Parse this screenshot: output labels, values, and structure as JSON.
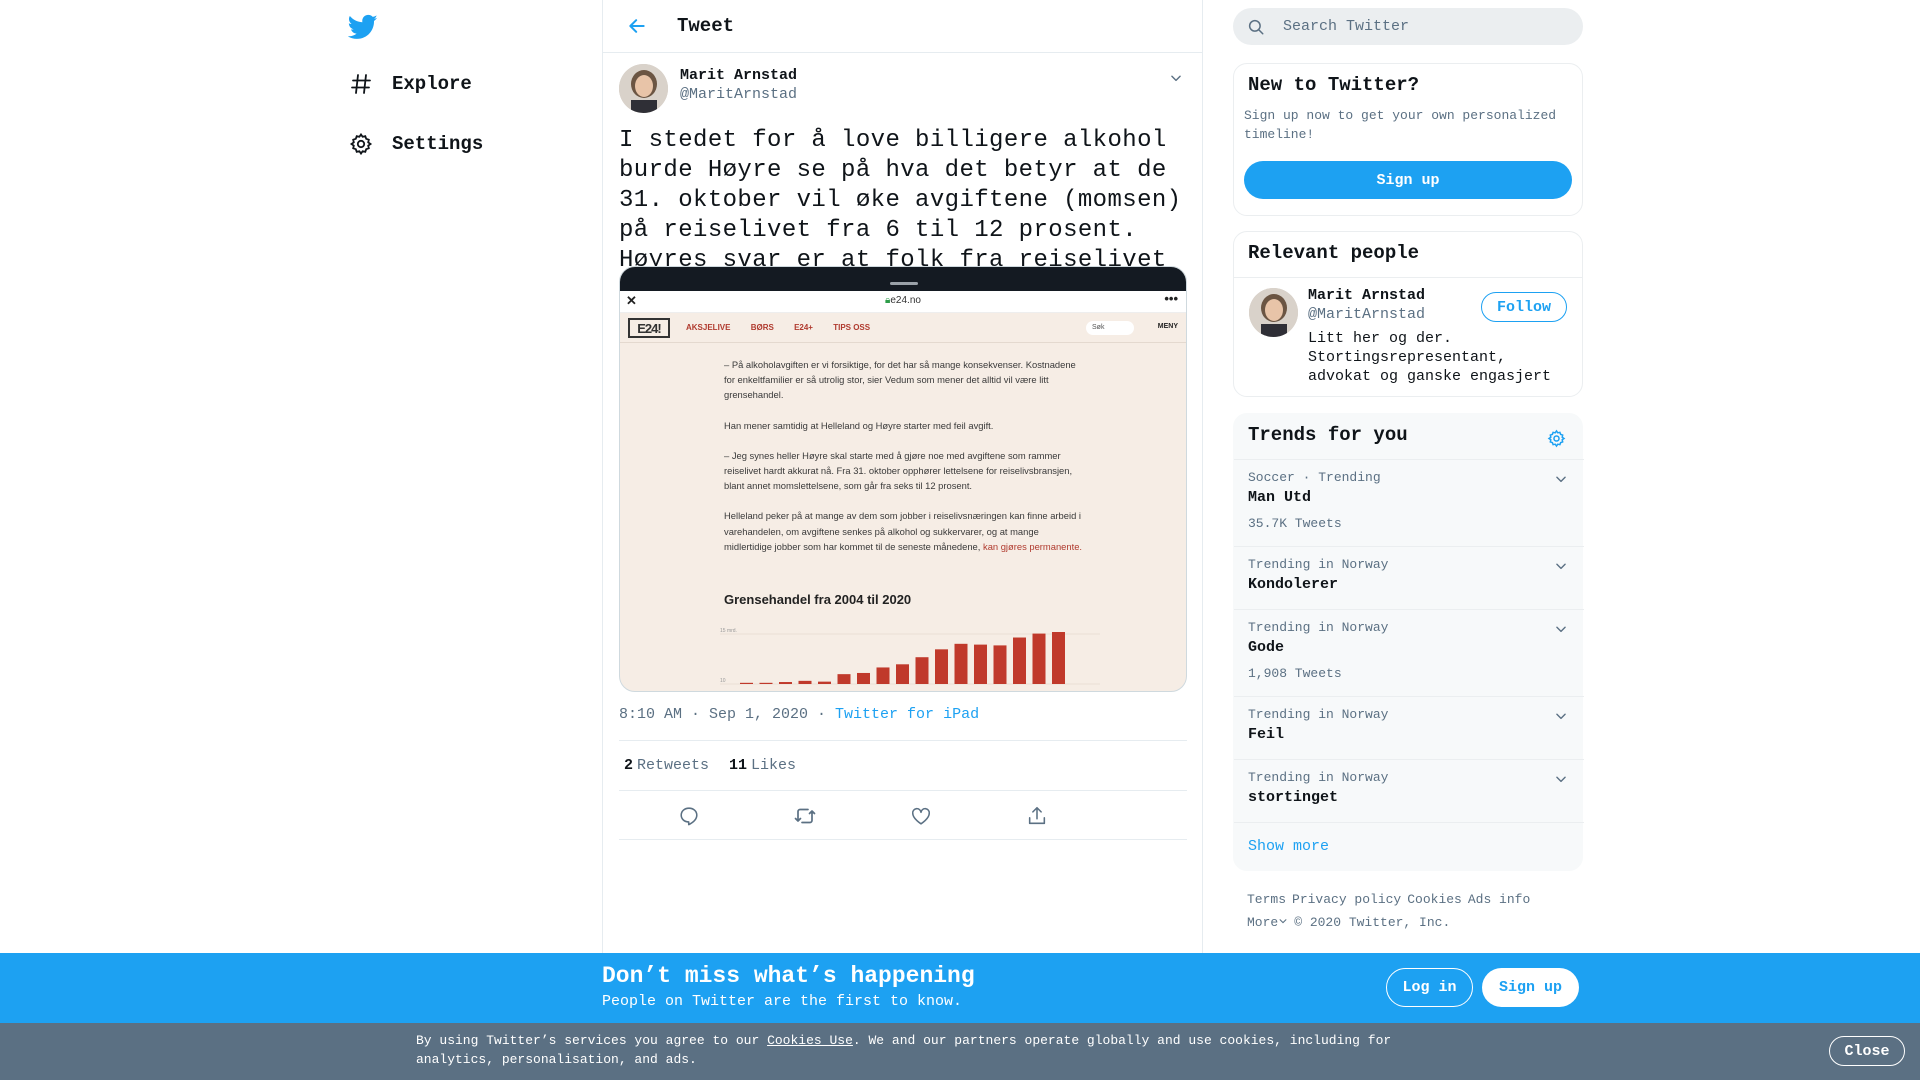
{
  "nav": {
    "explore_label": "Explore",
    "settings_label": "Settings"
  },
  "header": {
    "title": "Tweet"
  },
  "tweet": {
    "author_name": "Marit Arnstad",
    "author_handle": "@MaritArnstad",
    "text": "I stedet for å love billigere alkohol burde Høyre se på hva det betyr at de 31. oktober vil øke avgiftene (momsen) på reiselivet fra 6 til 12 prosent. Høyres svar er at folk fra reiselivet kan finne arbeid i varehandelen (??)",
    "time": "8:10 AM · Sep 1, 2020",
    "separator": " · ",
    "source": "Twitter for iPad",
    "retweets_count": "2",
    "retweets_label": "Retweets",
    "likes_count": "11",
    "likes_label": "Likes"
  },
  "media": {
    "url": "e24.no",
    "close": "✕",
    "more": "•••",
    "logo": "E24!",
    "nav_links": [
      "AKSJELIVE",
      "BØRS",
      "E24+",
      "TIPS OSS"
    ],
    "search": "Søk",
    "menu": "MENY",
    "paragraphs": [
      "– På alkoholavgiften er vi forsiktige, for det har så mange konsekvenser. Kostnadene for enkeltfamilier er så utrolig stor, sier Vedum som mener det alltid vil være litt grensehandel.",
      "Han mener samtidig at Helleland og Høyre starter med feil avgift.",
      "– Jeg synes heller Høyre skal starte med å gjøre noe med avgiftene som rammer reiselivet hardt akkurat nå. Fra 31. oktober opphører lettelsene for reiselivsbransjen, blant annet momslettelsene, som går fra seks til 12 prosent.",
      "Helleland peker på at mange av dem som jobber i reiselivsnæringen kan finne arbeid i varehandelen, om avgiftene senkes på alkohol og sukkervarer, og at mange midlertidige jobber som har kommet til de seneste månedene,"
    ],
    "link_text": "kan gjøres permanente.",
    "chart_title": "Grensehandel fra 2004 til 2020",
    "y_tick_top": "15 mrd.",
    "y_tick_bottom": "10"
  },
  "chart_data": {
    "type": "bar",
    "title": "Grensehandel fra 2004 til 2020",
    "values": [
      0.3,
      0.3,
      0.5,
      0.8,
      0.6,
      2.5,
      2.8,
      4.2,
      5.0,
      6.8,
      8.8,
      10.2,
      10.0,
      9.8,
      11.8,
      12.8,
      13.2
    ],
    "color": "#c0392b"
  },
  "search": {
    "placeholder": "Search Twitter"
  },
  "new_card": {
    "title": "New to Twitter?",
    "text": "Sign up now to get your own personalized timeline!",
    "button": "Sign up"
  },
  "relevant": {
    "title": "Relevant people",
    "name": "Marit Arnstad",
    "handle": "@MaritArnstad",
    "bio": "Litt her og der. Stortingsrepresentant, advokat og ganske engasjert",
    "follow": "Follow"
  },
  "trends": {
    "title": "Trends for you",
    "items": [
      {
        "context": "Soccer · Trending",
        "name": "Man Utd",
        "count": "35.7K Tweets"
      },
      {
        "context": "Trending in Norway",
        "name": "Kondolerer",
        "count": ""
      },
      {
        "context": "Trending in Norway",
        "name": "Gode",
        "count": "1,908 Tweets"
      },
      {
        "context": "Trending in Norway",
        "name": "Feil",
        "count": ""
      },
      {
        "context": "Trending in Norway",
        "name": "stortinget",
        "count": ""
      }
    ],
    "show_more": "Show more"
  },
  "footer": {
    "terms": "Terms",
    "privacy": "Privacy policy",
    "cookies": "Cookies",
    "ads": "Ads info",
    "more": "More",
    "copyright": "© 2020 Twitter, Inc."
  },
  "banner": {
    "title": "Don’t miss what’s happening",
    "subtitle": "People on Twitter are the first to know.",
    "login": "Log in",
    "signup": "Sign up"
  },
  "cookie": {
    "text_before": "By using Twitter’s services you agree to our ",
    "link": "Cookies Use",
    "text_after": ". We and our partners operate globally and use cookies, including for analytics, personalisation, and ads.",
    "close": "Close"
  },
  "colors": {
    "accent": "#1da1f2",
    "text": "#0f1419",
    "secondary": "#5b7083",
    "cookie_bg": "#5b7083"
  }
}
